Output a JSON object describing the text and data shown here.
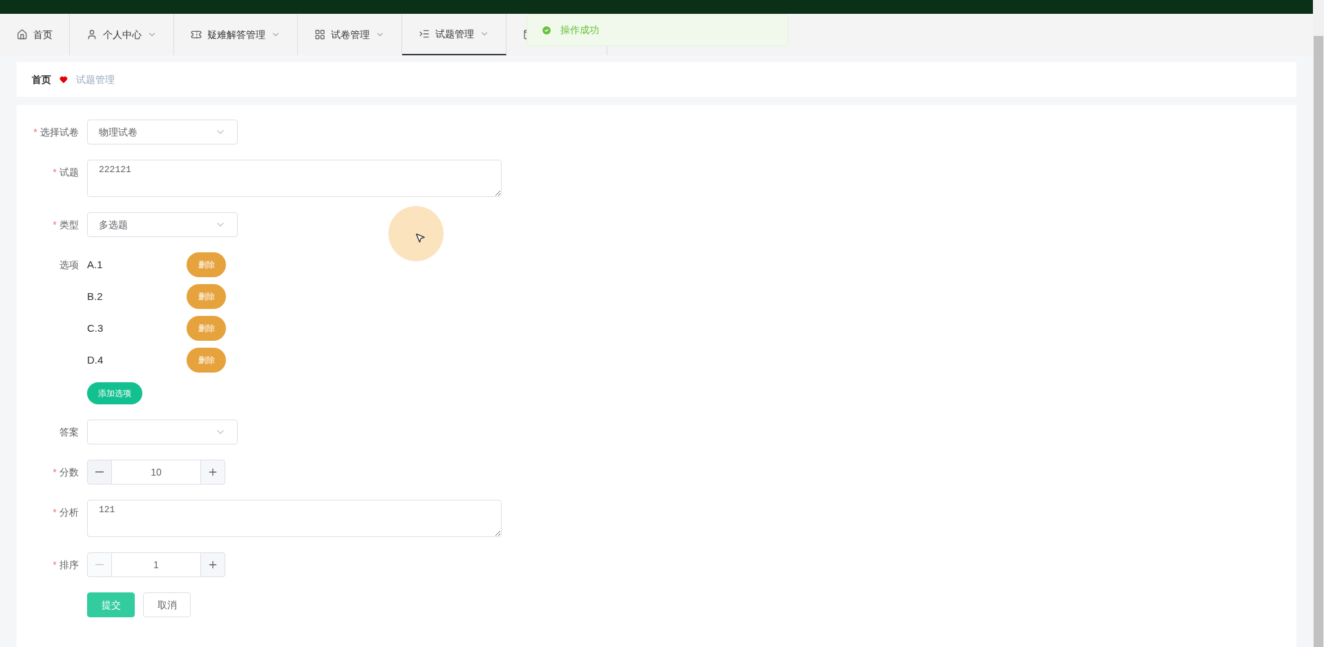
{
  "nav": {
    "tabs": [
      {
        "label": "首页",
        "selected": false,
        "dropdown": false
      },
      {
        "label": "个人中心",
        "selected": false,
        "dropdown": true
      },
      {
        "label": "疑难解答管理",
        "selected": false,
        "dropdown": true
      },
      {
        "label": "试卷管理",
        "selected": false,
        "dropdown": true
      },
      {
        "label": "试题管理",
        "selected": true,
        "dropdown": true
      }
    ]
  },
  "toast": {
    "message": "操作成功"
  },
  "breadcrumb": {
    "items": [
      "首页",
      "试题管理"
    ]
  },
  "form": {
    "fields": [
      {
        "kind": "select",
        "label": "选择试卷",
        "asterisk": "*",
        "value": "物理试卷"
      },
      {
        "kind": "textarea",
        "label": "试题",
        "asterisk": "*",
        "value": "222121"
      },
      {
        "kind": "select",
        "label": "类型",
        "asterisk": "*",
        "value": "多选题"
      },
      {
        "kind": "options",
        "label": "选项",
        "options": [
          {
            "text": "A.1",
            "action": "删除"
          },
          {
            "text": "B.2",
            "action": "删除"
          },
          {
            "text": "C.3",
            "action": "删除"
          },
          {
            "text": "D.4",
            "action": "删除"
          }
        ],
        "add_button": "添加选项"
      },
      {
        "kind": "select",
        "label": "答案"
      },
      {
        "kind": "number",
        "label": "分数",
        "asterisk": "*",
        "value": "10",
        "decrement_disabled": false
      },
      {
        "kind": "textarea",
        "label": "分析",
        "asterisk": "*",
        "value": "121"
      },
      {
        "kind": "number",
        "label": "排序",
        "asterisk": "*",
        "value": "1",
        "decrement_disabled": true
      }
    ],
    "buttons": [
      {
        "label": "提交",
        "kind": "primary"
      },
      {
        "label": "取消",
        "kind": "default"
      }
    ]
  }
}
